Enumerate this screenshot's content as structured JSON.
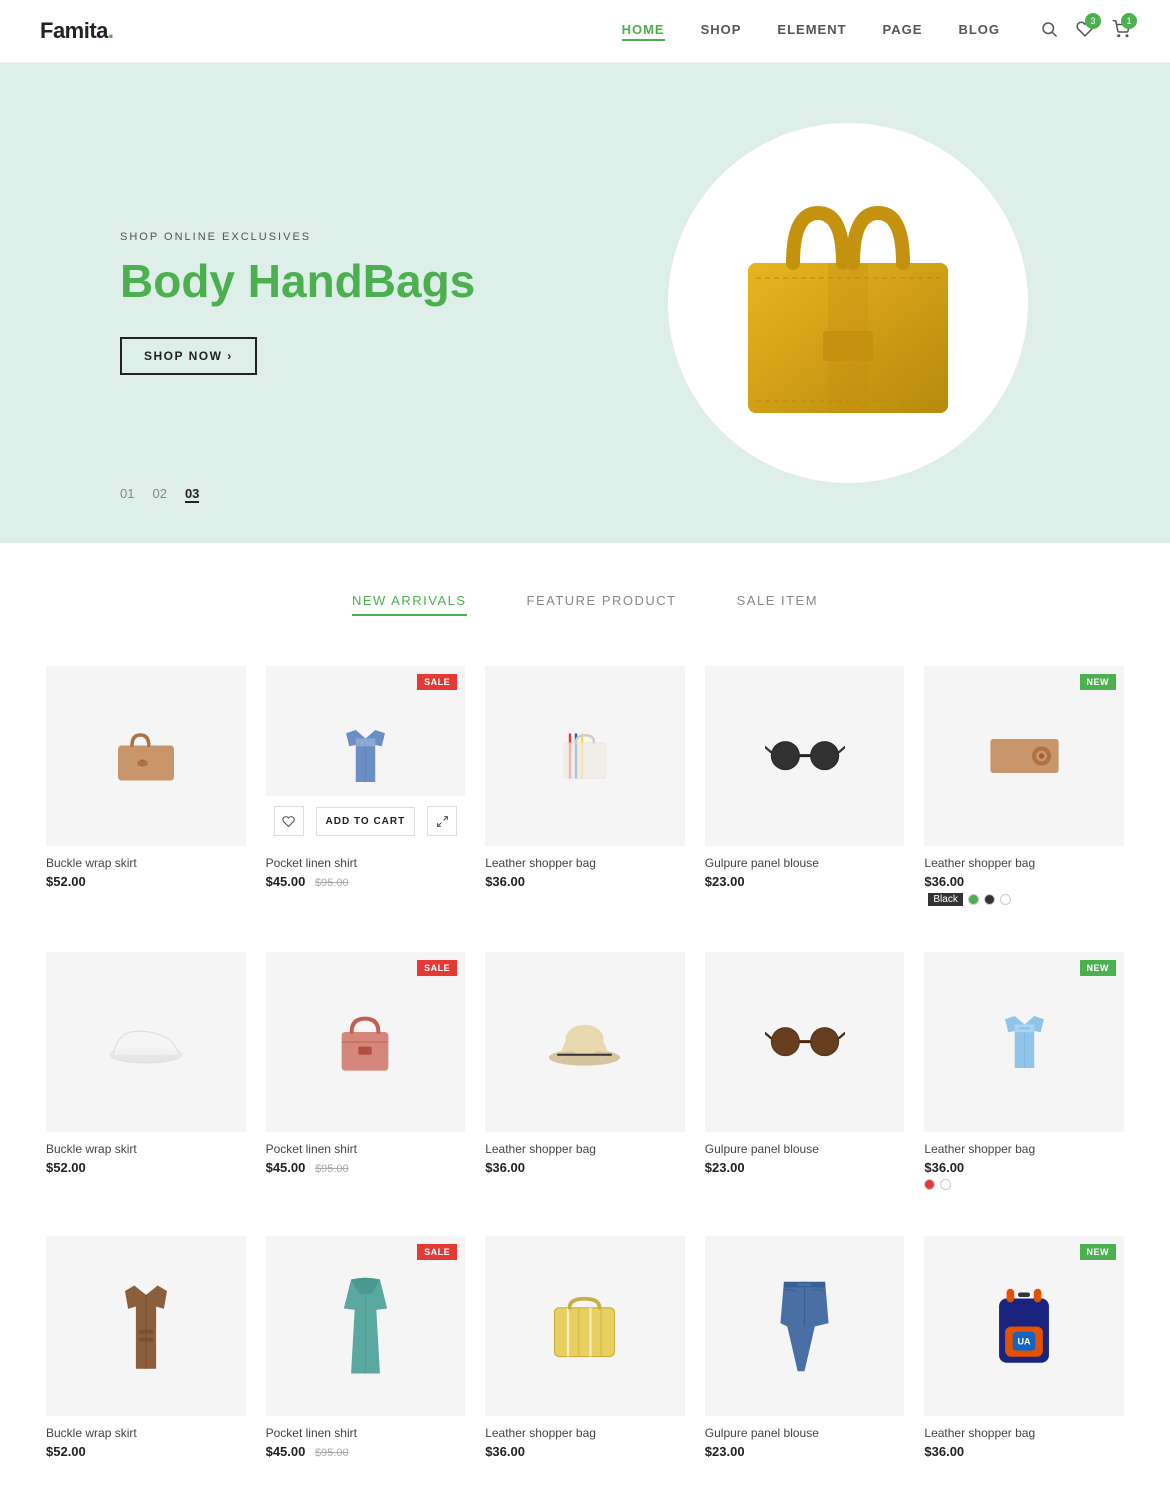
{
  "header": {
    "logo": "Famita",
    "logo_dot": ".",
    "nav": [
      {
        "label": "HOME",
        "active": true
      },
      {
        "label": "SHOP",
        "active": false
      },
      {
        "label": "ELEMENT",
        "active": false
      },
      {
        "label": "PAGE",
        "active": false
      },
      {
        "label": "BLOG",
        "active": false
      }
    ],
    "search_icon": "🔍",
    "wishlist_count": "3",
    "cart_count": "1"
  },
  "hero": {
    "subtitle": "SHOP ONLINE EXCLUSIVES",
    "title_black": "Body ",
    "title_green": "HandBags",
    "btn_label": "SHOP NOW",
    "indicators": [
      "01",
      "02",
      "03"
    ],
    "active_indicator": "03"
  },
  "tabs": {
    "items": [
      {
        "label": "NEW ARRIVALS",
        "active": true
      },
      {
        "label": "FEATURE PRODUCT",
        "active": false
      },
      {
        "label": "SALE ITEM",
        "active": false
      }
    ]
  },
  "products_row1": [
    {
      "name": "Buckle wrap skirt",
      "price": "$52.00",
      "old_price": "",
      "badge": "",
      "colors": [],
      "color_label": "",
      "type": "bag_tan"
    },
    {
      "name": "Pocket linen shirt",
      "price": "$45.00",
      "old_price": "$95.00",
      "badge": "SALE",
      "colors": [],
      "color_label": "",
      "type": "shirt_blue"
    },
    {
      "name": "Leather shopper bag",
      "price": "$36.00",
      "old_price": "",
      "badge": "",
      "colors": [],
      "color_label": "",
      "type": "bag_white"
    },
    {
      "name": "Gulpure panel blouse",
      "price": "$23.00",
      "old_price": "",
      "badge": "",
      "colors": [],
      "color_label": "",
      "type": "sunglasses_dark"
    },
    {
      "name": "Leather shopper bag",
      "price": "$36.00",
      "old_price": "",
      "badge": "NEW",
      "colors": [
        "#4caf50",
        "#333",
        "#fff"
      ],
      "color_label": "Black",
      "type": "wallet_tan"
    }
  ],
  "products_row2": [
    {
      "name": "Buckle wrap skirt",
      "price": "$52.00",
      "old_price": "",
      "badge": "",
      "colors": [],
      "color_label": "",
      "type": "shoes_white"
    },
    {
      "name": "Pocket linen shirt",
      "price": "$45.00",
      "old_price": "$95.00",
      "badge": "SALE",
      "colors": [],
      "color_label": "",
      "type": "bag_pink"
    },
    {
      "name": "Leather shopper bag",
      "price": "$36.00",
      "old_price": "",
      "badge": "",
      "colors": [],
      "color_label": "",
      "type": "hat_beige"
    },
    {
      "name": "Gulpure panel blouse",
      "price": "$23.00",
      "old_price": "",
      "badge": "",
      "colors": [],
      "color_label": "",
      "type": "sunglasses_brown"
    },
    {
      "name": "Leather shopper bag",
      "price": "$36.00",
      "old_price": "",
      "badge": "NEW",
      "colors": [
        "#e53935",
        "#fff"
      ],
      "color_label": "",
      "type": "shirt_light_blue"
    }
  ],
  "products_row3": [
    {
      "name": "Buckle wrap skirt",
      "price": "$52.00",
      "old_price": "",
      "badge": "",
      "colors": [],
      "color_label": "",
      "type": "coat_brown"
    },
    {
      "name": "Pocket linen shirt",
      "price": "$45.00",
      "old_price": "$95.00",
      "badge": "SALE",
      "colors": [],
      "color_label": "",
      "type": "dress_teal"
    },
    {
      "name": "Leather shopper bag",
      "price": "$36.00",
      "old_price": "",
      "badge": "",
      "colors": [],
      "color_label": "",
      "type": "bag_yellow_stripe"
    },
    {
      "name": "Gulpure panel blouse",
      "price": "$23.00",
      "old_price": "",
      "badge": "",
      "colors": [],
      "color_label": "",
      "type": "jeans_blue"
    },
    {
      "name": "Leather shopper bag",
      "price": "$36.00",
      "old_price": "",
      "badge": "NEW",
      "colors": [],
      "color_label": "",
      "type": "backpack_colorful"
    }
  ],
  "add_to_cart_label": "ADD TO CART",
  "wish_icon": "♡",
  "quick_icon": "⟷"
}
